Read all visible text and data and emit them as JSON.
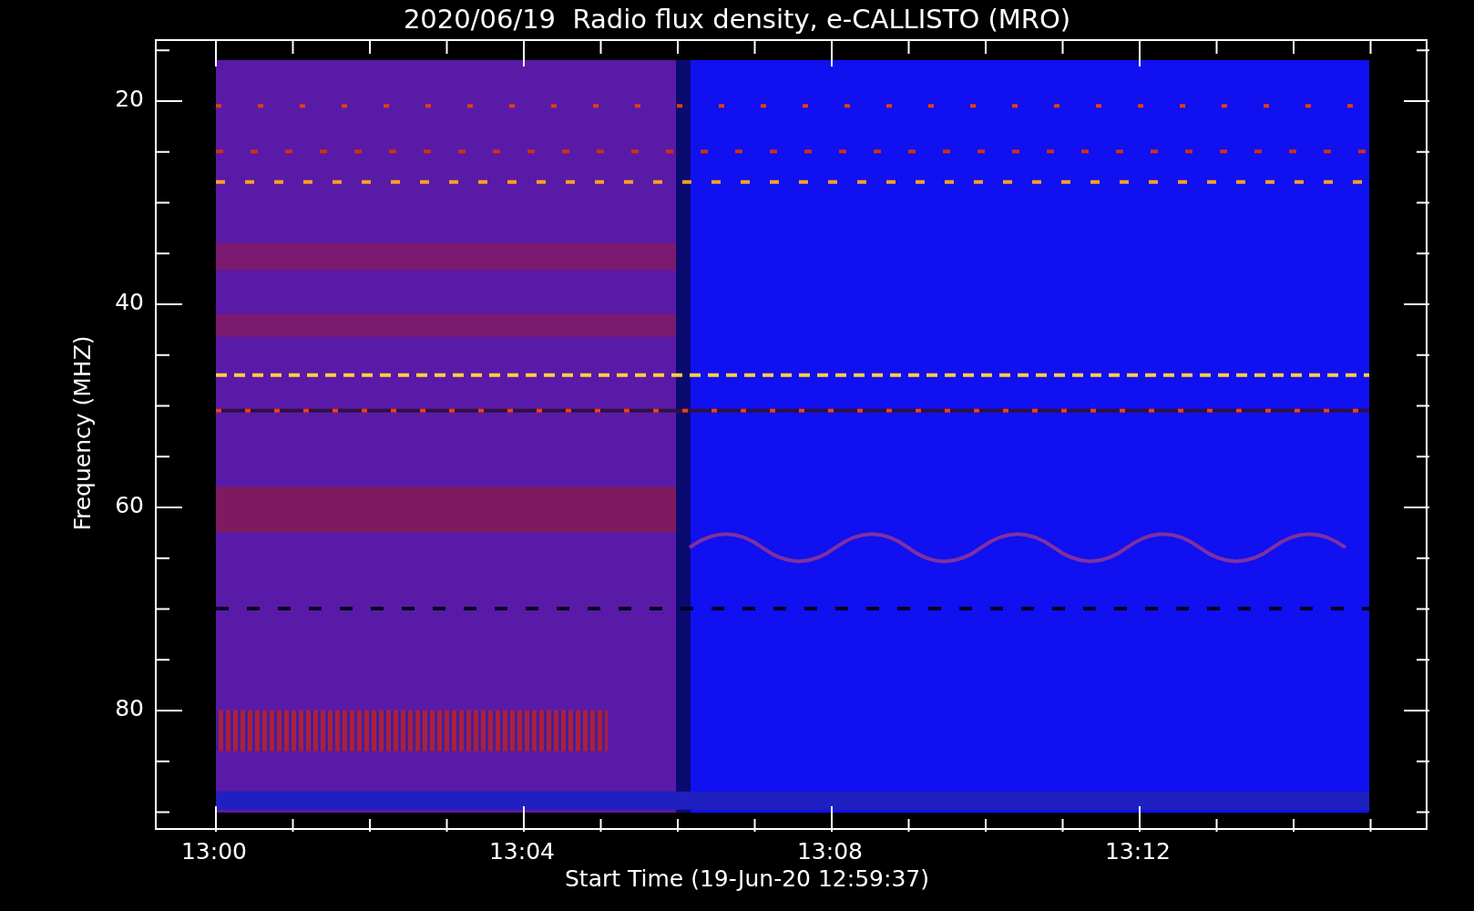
{
  "title": "2020/06/19  Radio flux density, e-CALLISTO (MRO)",
  "plot": {
    "ylabel": "Frequency (MHZ)",
    "xlabel": "Start Time (19-Jun-20 12:59:37)",
    "yticks": [
      "20",
      "40",
      "60",
      "80"
    ],
    "xticks": [
      "13:00",
      "13:04",
      "13:08",
      "13:12"
    ]
  }
}
